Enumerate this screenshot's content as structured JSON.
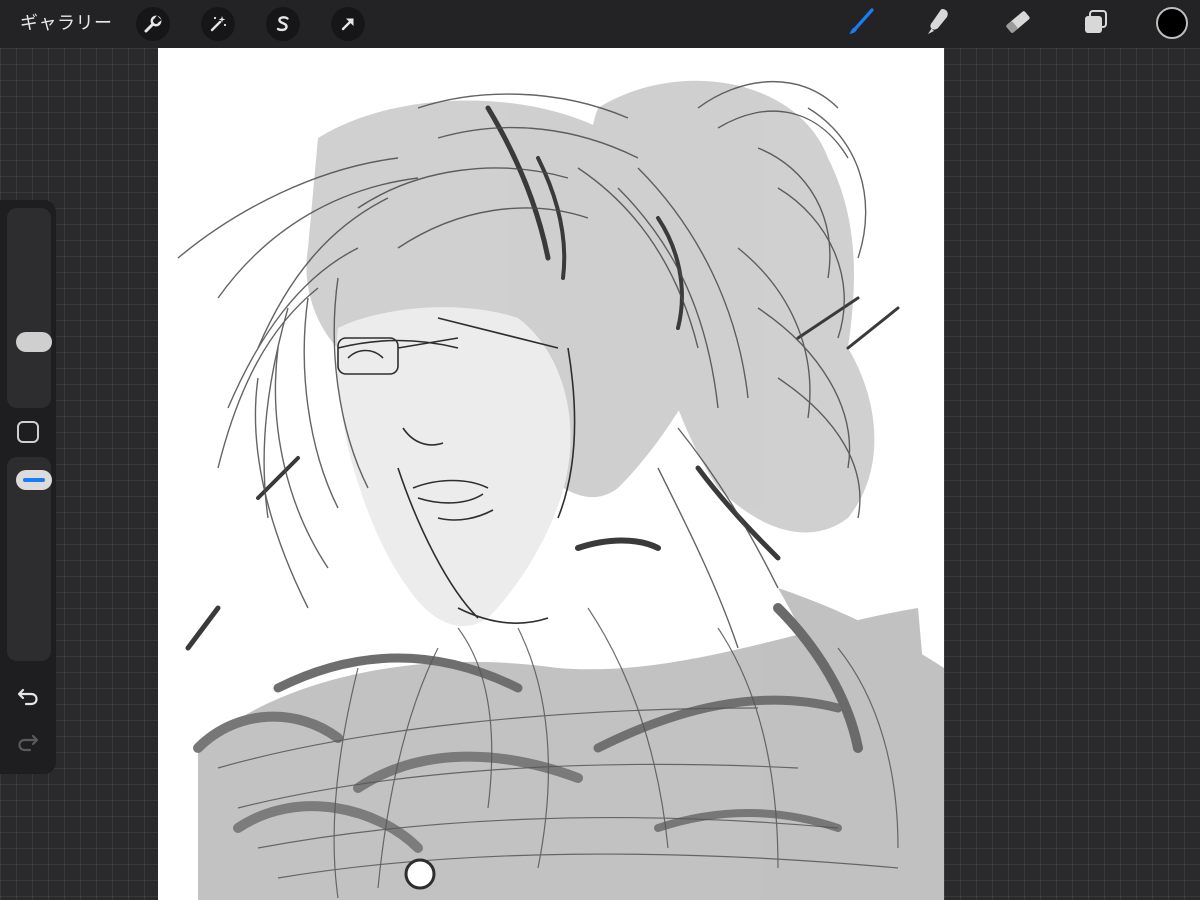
{
  "topbar": {
    "gallery_label": "ギャラリー",
    "left_tools": [
      "wrench-icon",
      "magic-wand-icon",
      "selection-icon",
      "transform-arrow-icon"
    ],
    "right_tools": [
      "brush-icon",
      "smudge-icon",
      "eraser-icon",
      "layers-icon"
    ],
    "active_tool": "brush-icon"
  },
  "colors": {
    "accent": "#1a7cf2",
    "current_color": "#000000",
    "topbar_bg": "#232325",
    "canvas_bg": "#ffffff"
  },
  "sidebar": {
    "brush_size_level": 0.3,
    "opacity_level": 0.95,
    "icons": [
      "modify-square-icon",
      "undo-icon",
      "redo-icon"
    ]
  }
}
